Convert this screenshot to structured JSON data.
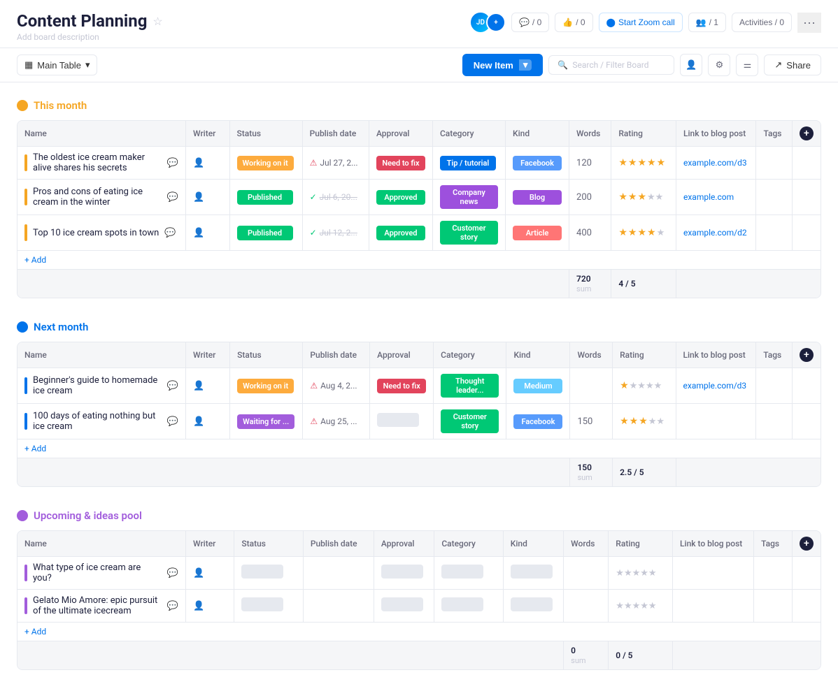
{
  "header": {
    "title": "Content Planning",
    "star_icon": "★",
    "board_desc": "Add board description",
    "zoom_btn": "Start Zoom call",
    "user_count": "1",
    "activities": "Activities / 0",
    "chat_count": "0",
    "like_count": "0"
  },
  "toolbar": {
    "table_label": "Main Table",
    "new_item": "New Item",
    "search_placeholder": "Search / Filter Board",
    "share_label": "Share"
  },
  "groups": [
    {
      "id": "this-month",
      "title": "This month",
      "color": "#f5a623",
      "dot_color": "#f5a623",
      "items": [
        {
          "name": "The oldest ice cream maker alive shares his secrets",
          "status": "Working on it",
          "status_class": "status-working",
          "publish_date": "Jul 27, 2...",
          "publish_icon": "warning",
          "approval": "Need to fix",
          "approval_class": "approval-fix",
          "category": "Tip / tutorial",
          "category_class": "cat-tip",
          "kind": "Facebook",
          "kind_class": "kind-facebook",
          "words": "120",
          "rating": 5,
          "link": "example.com/d3"
        },
        {
          "name": "Pros and cons of eating ice cream in the winter",
          "status": "Published",
          "status_class": "status-published",
          "publish_date": "Jul 6, 20...",
          "publish_icon": "ok",
          "date_strikethrough": true,
          "approval": "Approved",
          "approval_class": "approval-approved",
          "category": "Company news",
          "category_class": "cat-company",
          "kind": "Blog",
          "kind_class": "kind-blog",
          "words": "200",
          "rating": 3,
          "link": "example.com"
        },
        {
          "name": "Top 10 ice cream spots in town",
          "status": "Published",
          "status_class": "status-published",
          "publish_date": "Jul 12, 2...",
          "publish_icon": "ok",
          "date_strikethrough": true,
          "approval": "Approved",
          "approval_class": "approval-approved",
          "category": "Customer story",
          "category_class": "cat-customer",
          "kind": "Article",
          "kind_class": "kind-article",
          "words": "400",
          "rating": 4,
          "link": "example.com/d2"
        }
      ],
      "summary": {
        "words_sum": "720",
        "rating_avg": "4 / 5"
      }
    },
    {
      "id": "next-month",
      "title": "Next month",
      "color": "#0073ea",
      "dot_color": "#0073ea",
      "items": [
        {
          "name": "Beginner's guide to homemade ice cream",
          "status": "Working on it",
          "status_class": "status-working",
          "publish_date": "Aug 4, 2...",
          "publish_icon": "warning",
          "approval": "Need to fix",
          "approval_class": "approval-fix",
          "category": "Thought leader...",
          "category_class": "cat-thought",
          "kind": "Medium",
          "kind_class": "kind-medium",
          "words": "",
          "rating": 1,
          "link": "example.com/d3"
        },
        {
          "name": "100 days of eating nothing but ice cream",
          "status": "Waiting for ...",
          "status_class": "status-waiting",
          "publish_date": "Aug 25, ...",
          "publish_icon": "warning",
          "approval": "",
          "approval_class": "",
          "category": "Customer story",
          "category_class": "cat-customer",
          "kind": "Facebook",
          "kind_class": "kind-facebook",
          "words": "150",
          "rating": 3,
          "link": ""
        }
      ],
      "summary": {
        "words_sum": "150",
        "rating_avg": "2.5 / 5"
      }
    },
    {
      "id": "upcoming",
      "title": "Upcoming & ideas pool",
      "color": "#a25ddc",
      "dot_color": "#a25ddc",
      "items": [
        {
          "name": "What type of ice cream are you?",
          "status": "",
          "status_class": "",
          "publish_date": "",
          "publish_icon": "",
          "approval": "",
          "approval_class": "",
          "category": "",
          "category_class": "",
          "kind": "",
          "kind_class": "",
          "words": "",
          "rating": 0,
          "link": ""
        },
        {
          "name": "Gelato Mio Amore: epic pursuit of the ultimate icecream",
          "status": "",
          "status_class": "",
          "publish_date": "",
          "publish_icon": "",
          "approval": "",
          "approval_class": "",
          "category": "",
          "category_class": "",
          "kind": "",
          "kind_class": "",
          "words": "",
          "rating": 0,
          "link": ""
        }
      ],
      "summary": {
        "words_sum": "0",
        "rating_avg": "0 / 5"
      }
    }
  ],
  "columns": {
    "name": "Name",
    "writer": "Writer",
    "status": "Status",
    "publish_date": "Publish date",
    "approval": "Approval",
    "category": "Category",
    "kind": "Kind",
    "words": "Words",
    "rating": "Rating",
    "link": "Link to blog post",
    "tags": "Tags"
  }
}
